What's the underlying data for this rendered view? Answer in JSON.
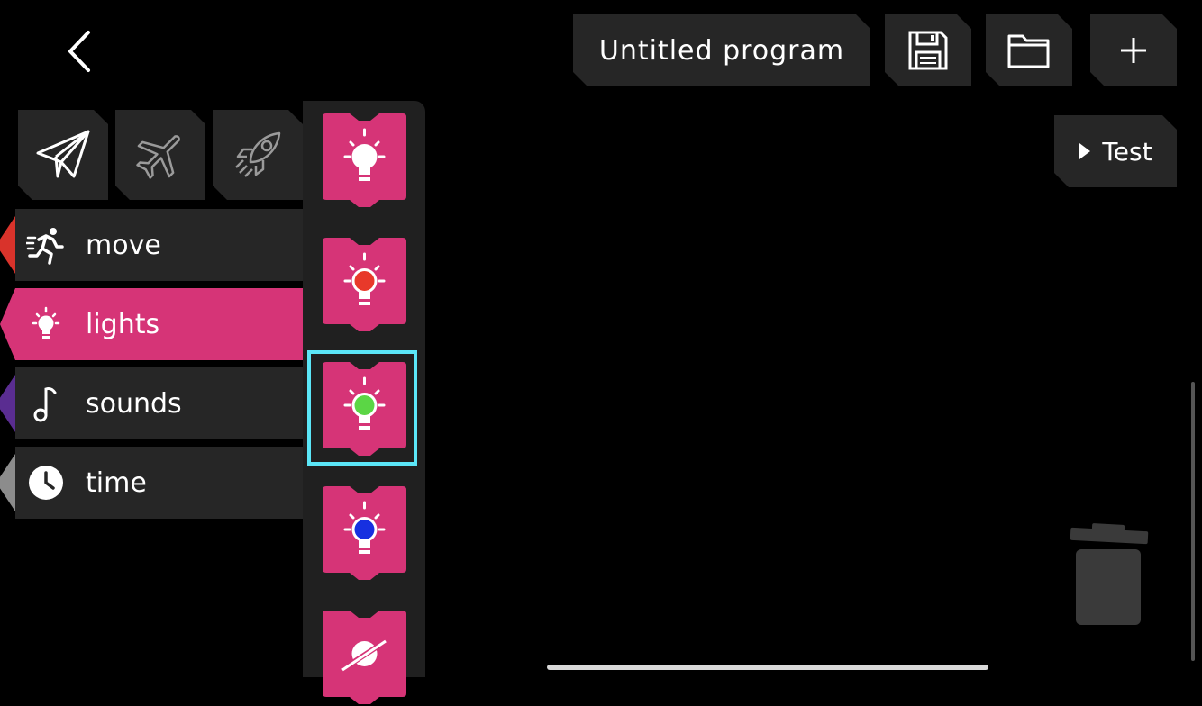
{
  "header": {
    "program_title": "Untitled program",
    "test_label": "Test"
  },
  "icons": {
    "back": "chevron-left-icon",
    "save": "floppy-disk-icon",
    "open": "folder-icon",
    "new": "plus-icon",
    "play": "play-triangle-icon",
    "trash": "trash-icon"
  },
  "vehicles": [
    {
      "name": "paper-plane",
      "active": true
    },
    {
      "name": "airplane",
      "active": false
    },
    {
      "name": "rocket",
      "active": false
    }
  ],
  "categories": [
    {
      "label": "move",
      "color": "#d9332b",
      "active": false
    },
    {
      "label": "lights",
      "color": "#d63477",
      "active": true
    },
    {
      "label": "sounds",
      "color": "#5a2d91",
      "active": false
    },
    {
      "label": "time",
      "color": "#8c8c8c",
      "active": false
    }
  ],
  "blocks": [
    {
      "bulb_color": "#ffffff",
      "selected": false
    },
    {
      "bulb_color": "#e8392a",
      "selected": false
    },
    {
      "bulb_color": "#5bd645",
      "selected": true
    },
    {
      "bulb_color": "#1730e0",
      "selected": false
    },
    {
      "bulb_color": "off",
      "selected": false
    }
  ],
  "colors": {
    "accent_pink": "#d63477",
    "selection_cyan": "#5be6f7",
    "button_bg": "#262626"
  }
}
